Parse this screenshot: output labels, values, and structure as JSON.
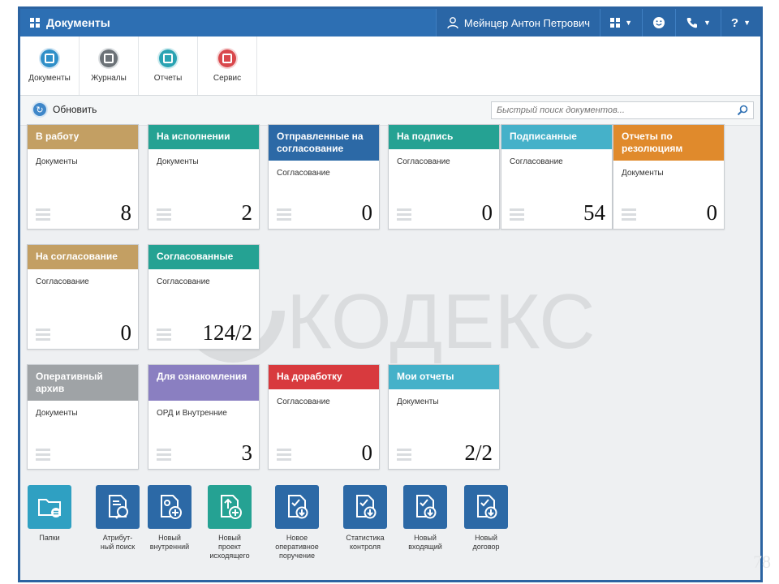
{
  "app": {
    "title": "Документы",
    "user_name": "Мейнцер Антон Петрович"
  },
  "launcher": [
    {
      "label": "Документы",
      "color": "#2f8fc8"
    },
    {
      "label": "Журналы",
      "color": "#6c7277"
    },
    {
      "label": "Отчеты",
      "color": "#2aa3b3"
    },
    {
      "label": "Сервис",
      "color": "#d9484c"
    }
  ],
  "toolbar": {
    "refresh_label": "Обновить",
    "search_placeholder": "Быстрый поиск документов..."
  },
  "tiles": [
    {
      "title": "В работу",
      "subtitle": "Документы",
      "count": "8",
      "color": "#c39f63"
    },
    {
      "title": "На исполнении",
      "subtitle": "Документы",
      "count": "2",
      "color": "#25a293"
    },
    {
      "title": "Отправленные на согласование",
      "subtitle": "Согласование",
      "count": "0",
      "color": "#2c69a6"
    },
    {
      "title": "На подпись",
      "subtitle": "Согласование",
      "count": "0",
      "color": "#25a293"
    },
    {
      "title": "Подписанные",
      "subtitle": "Согласование",
      "count": "54",
      "color": "#45b1c9"
    },
    {
      "title": "Отчеты по резолюциям",
      "subtitle": "Документы",
      "count": "0",
      "color": "#e08a2c"
    },
    {
      "title": "На согласование",
      "subtitle": "Согласование",
      "count": "0",
      "color": "#c39f63"
    },
    {
      "title": "Согласованные",
      "subtitle": "Согласование",
      "count": "124/2",
      "color": "#25a293"
    },
    {
      "title": "Оперативный архив",
      "subtitle": "Документы",
      "count": "",
      "color": "#9fa3a6"
    },
    {
      "title": "Для ознакомления",
      "subtitle": "ОРД и Внутренние",
      "count": "3",
      "color": "#8a7fc1"
    },
    {
      "title": "На доработку",
      "subtitle": "Согласование",
      "count": "0",
      "color": "#d83a3e"
    },
    {
      "title": "Мои отчеты",
      "subtitle": "Документы",
      "count": "2/2",
      "color": "#45b1c9"
    }
  ],
  "actions": [
    {
      "label": "Папки",
      "icon": "folder-icon",
      "color": "#2fa0c2"
    },
    {
      "label": "Атрибут-\nный поиск",
      "icon": "search-document-icon",
      "color": "#2c69a6"
    },
    {
      "label": "Новый\nвнутренний",
      "icon": "new-document-icon",
      "color": "#2c69a6"
    },
    {
      "label": "Новый\nпроект\nисходящего",
      "icon": "upload-document-icon",
      "color": "#25a293"
    },
    {
      "label": "Новое\nоперативное\nпоручение",
      "icon": "task-document-icon",
      "color": "#2c69a6"
    },
    {
      "label": "Статистика\nконтроля",
      "icon": "statistics-document-icon",
      "color": "#2c69a6"
    },
    {
      "label": "Новый\nвходящий",
      "icon": "incoming-document-icon",
      "color": "#2c69a6"
    },
    {
      "label": "Новый\nдоговор",
      "icon": "contract-document-icon",
      "color": "#2c69a6"
    }
  ],
  "watermark_text": "КОДЕКС",
  "page_number": "78"
}
